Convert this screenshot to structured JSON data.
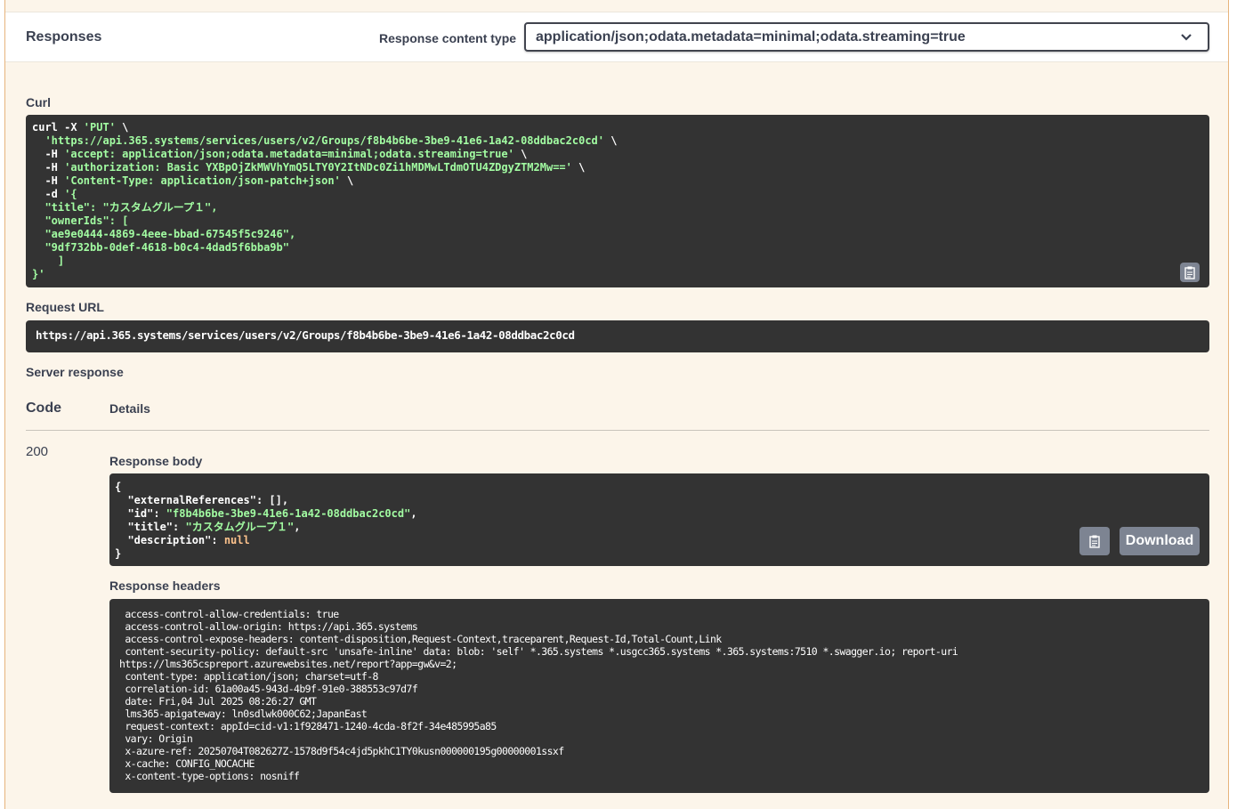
{
  "responses": {
    "title": "Responses",
    "content_type_label": "Response content type",
    "content_type_value": "application/json;odata.metadata=minimal;odata.streaming=true"
  },
  "curl": {
    "label": "Curl",
    "line1_pre": "curl -X ",
    "line1_str": "'PUT'",
    "line1_post": " \\",
    "line2_str": "  'https://api.365.systems/services/users/v2/Groups/f8b4b6be-3be9-41e6-1a42-08ddbac2c0cd'",
    "line2_post": " \\",
    "line3_pre": "  -H ",
    "line3_str": "'accept: application/json;odata.metadata=minimal;odata.streaming=true'",
    "line3_post": " \\",
    "line4_pre": "  -H ",
    "line4_str": "'authorization: Basic YXBpOjZkMWVhYmQ5LTY0Y2ItNDc0Zi1hMDMwLTdmOTU4ZDgyZTM2Mw=='",
    "line4_post": " \\",
    "line5_pre": "  -H ",
    "line5_str": "'Content-Type: application/json-patch+json'",
    "line5_post": " \\",
    "line6_pre": "  -d ",
    "line6_str": "'{",
    "line7_str": "  \"title\": \"カスタムグループ１\",",
    "line8_str": "  \"ownerIds\": [",
    "line9_str": "  \"ae9e0444-4869-4eee-bbad-67545f5c9246\",",
    "line10_str": "  \"9df732bb-0def-4618-b0c4-4dad5f6bba9b\"",
    "line11_str": "    ]",
    "line12_str": "}'"
  },
  "request_url": {
    "label": "Request URL",
    "value": "https://api.365.systems/services/users/v2/Groups/f8b4b6be-3be9-41e6-1a42-08ddbac2c0cd"
  },
  "server_response": {
    "label": "Server response",
    "col_code": "Code",
    "col_details": "Details",
    "status_code": "200",
    "body_label": "Response body",
    "download_label": "Download",
    "body": {
      "open": "{",
      "k1": "  \"externalReferences\": [],",
      "k2_key": "  \"id\": ",
      "k2_val": "\"f8b4b6be-3be9-41e6-1a42-08ddbac2c0cd\"",
      "k2_post": ",",
      "k3_key": "  \"title\": ",
      "k3_val": "\"カスタムグループ１\"",
      "k3_post": ",",
      "k4_key": "  \"description\": ",
      "k4_val": "null",
      "close": "}"
    },
    "headers_label": "Response headers",
    "headers": [
      " access-control-allow-credentials: true",
      " access-control-allow-origin: https://api.365.systems",
      " access-control-expose-headers: content-disposition,Request-Context,traceparent,Request-Id,Total-Count,Link",
      " content-security-policy: default-src 'unsafe-inline' data: blob: 'self' *.365.systems *.usgcc365.systems *.365.systems:7510 *.swagger.io; report-uri",
      "https://lms365cspreport.azurewebsites.net/report?app=gw&v=2;",
      " content-type: application/json; charset=utf-8",
      " correlation-id: 61a00a45-943d-4b9f-91e0-388553c97d7f",
      " date: Fri,04 Jul 2025 08:26:27 GMT",
      " lms365-apigateway: ln0sdlwk000C62;JapanEast",
      " request-context: appId=cid-v1:1f928471-1240-4cda-8f2f-34e485995a85",
      " vary: Origin",
      " x-azure-ref: 20250704T082627Z-1578d9f54c4jd5pkhC1TY0kusn000000195g00000001ssxf",
      " x-cache: CONFIG_NOCACHE",
      " x-content-type-options: nosniff"
    ]
  },
  "icons": {
    "chevron": "chevron-down-icon",
    "copy": "clipboard-copy-icon"
  }
}
